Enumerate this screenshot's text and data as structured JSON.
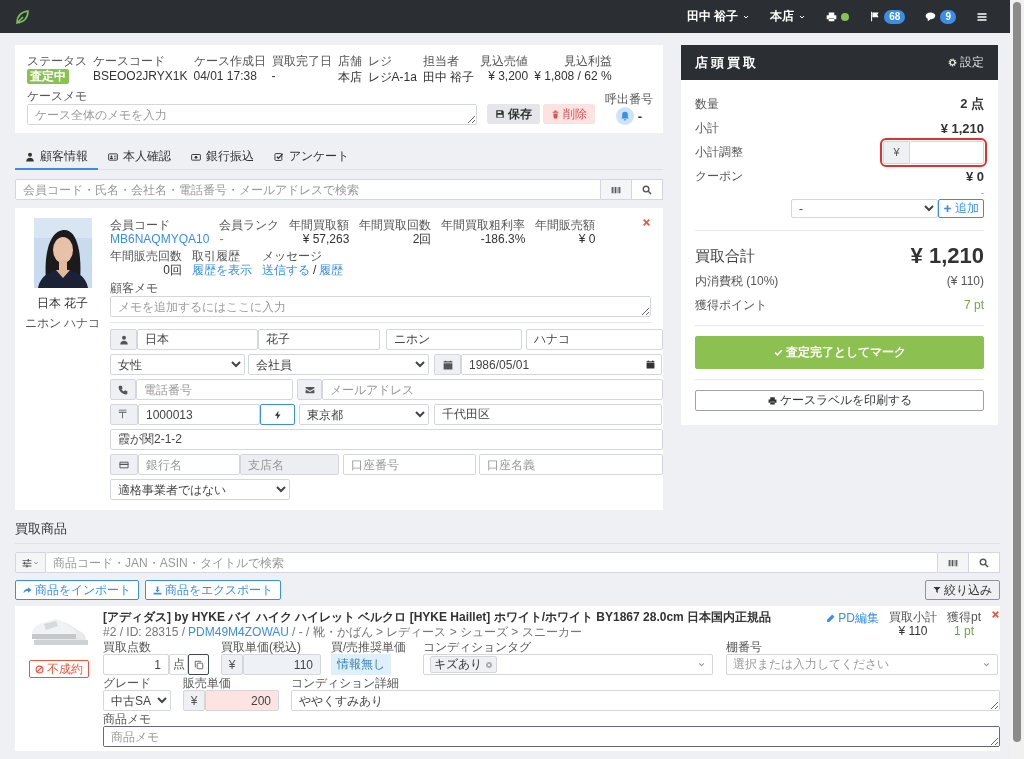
{
  "topbar": {
    "user": "田中 裕子",
    "store": "本店",
    "printer_online": true,
    "flag_count": "68",
    "message_count": "9"
  },
  "case": {
    "fields": [
      {
        "label": "ステータス",
        "value": "査定中",
        "kind": "badge"
      },
      {
        "label": "ケースコード",
        "value": "BSEOO2JRYX1K",
        "kind": "text"
      },
      {
        "label": "ケース作成日",
        "value": "04/01 17:38",
        "kind": "text"
      },
      {
        "label": "買取完了日",
        "value": "-",
        "kind": "text"
      },
      {
        "label": "店舗",
        "value": "本店",
        "kind": "text"
      },
      {
        "label": "レジ",
        "value": "レジA-1a",
        "kind": "text"
      },
      {
        "label": "担当者",
        "value": "田中 裕子",
        "kind": "text"
      },
      {
        "label": "見込売値",
        "value": "¥ 3,200",
        "kind": "number"
      },
      {
        "label": "見込利益",
        "value": "¥ 1,808 / 62 %",
        "kind": "number"
      }
    ],
    "save_button": "保存",
    "delete_button": "削除",
    "memo_label": "ケースメモ",
    "memo_placeholder": "ケース全体のメモを入力",
    "call_label": "呼出番号",
    "call_number": "-"
  },
  "customer_tabs": [
    {
      "label": "顧客情報",
      "kind": "person",
      "selected": true
    },
    {
      "label": "本人確認",
      "kind": "idcard",
      "selected": false
    },
    {
      "label": "銀行振込",
      "kind": "money",
      "selected": false
    },
    {
      "label": "アンケート",
      "kind": "survey",
      "selected": false
    }
  ],
  "customer_search": {
    "placeholder": "会員コード・氏名・会社名・電話番号・メールアドレスで検索"
  },
  "customer": {
    "name": "日本 花子",
    "kana": "ニホン ハナコ",
    "stats": [
      {
        "label": "会員コード",
        "value": "MB6NAQMYQA10",
        "kind": "link"
      },
      {
        "label": "会員ランク",
        "value": "-",
        "kind": "alert"
      },
      {
        "label": "年間買取額",
        "value": "¥ 57,263",
        "kind": "number"
      },
      {
        "label": "年間買取回数",
        "value": "2回",
        "kind": "number"
      },
      {
        "label": "年間買取粗利率",
        "value": "-186.3%",
        "kind": "number"
      },
      {
        "label": "年間販売額",
        "value": "¥ 0",
        "kind": "number"
      },
      {
        "label": "年間販売回数",
        "value": "0回",
        "kind": "number"
      },
      {
        "label": "取引履歴",
        "links": [
          "履歴を表示"
        ],
        "kind": "links"
      },
      {
        "label": "メッセージ",
        "links": [
          "送信する",
          "履歴"
        ],
        "separator": "/",
        "kind": "links"
      }
    ],
    "memo_label": "顧客メモ",
    "memo_placeholder": "メモを追加するにはここに入力",
    "form_rows": [
      [
        {
          "kind": "person"
        },
        {
          "kind": "input",
          "value": "日本"
        },
        {
          "kind": "input",
          "value": "花子"
        },
        {
          "kind": "input",
          "value": "ニホン"
        },
        {
          "kind": "input",
          "value": "ハナコ"
        }
      ],
      [
        {
          "kind": "select",
          "value": "女性"
        },
        {
          "kind": "select",
          "value": "会社員"
        },
        {
          "kind": "calendar"
        },
        {
          "kind": "date",
          "value": "1986/05/01"
        }
      ],
      [
        {
          "kind": "phone"
        },
        {
          "kind": "input",
          "placeholder": "電話番号"
        },
        {
          "kind": "mail"
        },
        {
          "kind": "input",
          "placeholder": "メールアドレス"
        }
      ],
      [
        {
          "kind": "label",
          "text": "〒"
        },
        {
          "kind": "input",
          "value": "1000013"
        },
        {
          "kind": "bolt"
        },
        {
          "kind": "select",
          "value": "東京都"
        },
        {
          "kind": "input",
          "value": "千代田区"
        }
      ],
      [
        {
          "kind": "input",
          "value": "霞が関2-1-2"
        }
      ],
      [
        {
          "kind": "card"
        },
        {
          "kind": "input",
          "placeholder": "銀行名"
        },
        {
          "kind": "locked",
          "placeholder": "支店名"
        },
        {
          "kind": "input",
          "placeholder": "口座番号"
        },
        {
          "kind": "input",
          "placeholder": "口座名義"
        }
      ],
      [
        {
          "kind": "select",
          "value": "適格事業者ではない"
        }
      ]
    ]
  },
  "summary": {
    "title": "店頭買取",
    "settings": "設定",
    "rows": [
      {
        "label": "数量",
        "value": "2 点",
        "kind": "value"
      },
      {
        "label": "小計",
        "value": "¥ 1,210",
        "kind": "value"
      },
      {
        "label": "小計調整",
        "prefix": "¥",
        "kind": "input",
        "highlighted": true
      },
      {
        "label": "クーポン",
        "value": "¥ 0",
        "note": "-",
        "kind": "value"
      }
    ],
    "coupon_select": "-",
    "add_button": "追加",
    "total_label": "買取合計",
    "total": "¥ 1,210",
    "tax_label": "内消費税 (10%)",
    "tax": "(¥ 110)",
    "points_label": "獲得ポイント",
    "points": "7 pt",
    "complete_button": "査定完了としてマーク",
    "print_button": "ケースラベルを印刷する"
  },
  "products": {
    "title": "買取商品",
    "search_placeholder": "商品コード・JAN・ASIN・タイトルで検索",
    "import_button": "商品をインポート",
    "export_button": "商品をエクスポート",
    "filter_button": "絞り込み",
    "items": [
      {
        "status": "不成約",
        "title": "[アディダス] by HYKE バイ ハイク ハイレット ベルクロ [HYKE Haillet] ホワイト/ホワイト BY1867 28.0cm 日本国内正規品",
        "meta_prefix": "#2 / ID: 28315 /",
        "code": "PDM49M4ZOWAU",
        "meta_suffix": "/ - / 靴・かばん > レディース > シューズ > スニーカー",
        "edit_link": "PD編集",
        "subtotal_label": "買取小計",
        "subtotal": "¥ 110",
        "points_label": "獲得pt",
        "points": "1 pt",
        "quantity_label": "買取点数",
        "quantity": "1",
        "unit": "点",
        "price_label": "買取単価(税込)",
        "price_prefix": "¥",
        "price": "110",
        "recommend_label": "買/売推奨単価",
        "recommend": "情報無し",
        "tags_label": "コンディションタグ",
        "tags": [
          "キズあり"
        ],
        "shelf_label": "棚番号",
        "shelf_placeholder": "選択または入力してください",
        "grade_label": "グレード",
        "grade": "中古SA",
        "sale_price_label": "販売単価",
        "sale_price_prefix": "¥",
        "sale_price": "200",
        "detail_label": "コンディション詳細",
        "detail": "ややくすみあり",
        "memo_label": "商品メモ",
        "memo_placeholder": "商品メモ",
        "memo_focused": true
      }
    ]
  }
}
